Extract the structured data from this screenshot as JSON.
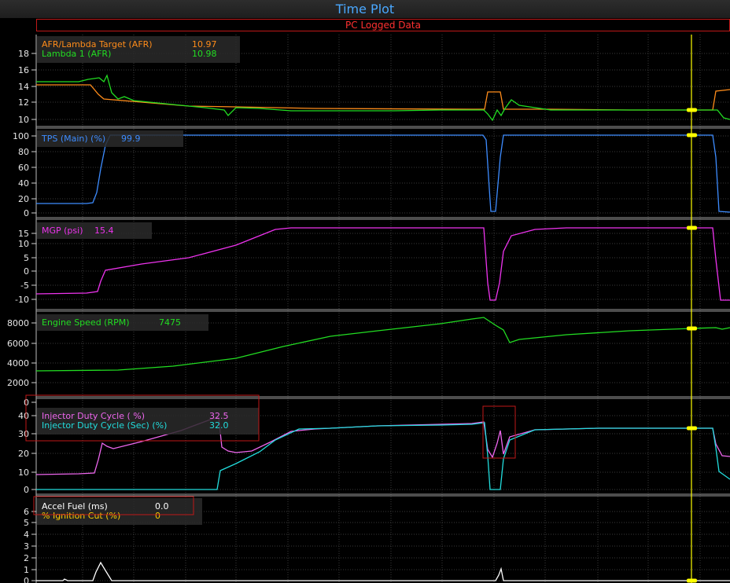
{
  "title": "Time Plot",
  "subtitle": "PC Logged Data",
  "colors": {
    "accent_title": "#4aa8ff",
    "subtitle_text": "#ff3030",
    "highlight_box": "#c01818",
    "cursor": "#ffff00",
    "grid": "#3a3a3a",
    "afr_target": "#ff8c1a",
    "lambda1": "#22dd22",
    "tps": "#3d8cff",
    "mgp": "#ee33ee",
    "rpm": "#22dd22",
    "idc": "#ee66ee",
    "idc_sec": "#22dddd",
    "accel": "#ffffff",
    "ign_cut": "#ffcc00"
  },
  "panels": [
    {
      "id": "afr",
      "yticks": [
        "18",
        "16",
        "14",
        "12",
        "10"
      ],
      "legend": [
        {
          "name": "AFR/Lambda Target (AFR)",
          "value": "10.97",
          "color": "#ff8c1a"
        },
        {
          "name": "Lambda 1 (AFR)",
          "value": "10.98",
          "color": "#22dd22"
        }
      ]
    },
    {
      "id": "tps",
      "yticks": [
        "100",
        "80",
        "60",
        "40",
        "20",
        "0"
      ],
      "legend": [
        {
          "name": "TPS (Main) (%)",
          "value": "99.9",
          "color": "#3d8cff"
        }
      ]
    },
    {
      "id": "mgp",
      "yticks": [
        "15",
        "10",
        "5",
        "0",
        "-5",
        "-10"
      ],
      "legend": [
        {
          "name": "MGP (psi)",
          "value": "15.4",
          "color": "#ee33ee"
        }
      ]
    },
    {
      "id": "rpm",
      "yticks": [
        "8000",
        "6000",
        "4000",
        "2000",
        "0"
      ],
      "legend": [
        {
          "name": "Engine Speed (RPM)",
          "value": "7475",
          "color": "#22dd22"
        }
      ]
    },
    {
      "id": "idc",
      "yticks": [
        "40",
        "30",
        "20",
        "10",
        "0"
      ],
      "legend": [
        {
          "name": "Injector Duty Cycle ( %)",
          "value": "32.5",
          "color": "#ee66ee"
        },
        {
          "name": "Injector Duty Cycle (Sec) (%)",
          "value": "32.0",
          "color": "#22dddd"
        }
      ]
    },
    {
      "id": "accel",
      "yticks": [
        "6",
        "5",
        "4",
        "3",
        "2",
        "1",
        "0"
      ],
      "legend": [
        {
          "name": "Accel Fuel (ms)",
          "value": "0.0",
          "color": "#ffffff"
        },
        {
          "name": "% Ignition Cut (%)",
          "value": "0",
          "color": "#ffcc00"
        }
      ]
    }
  ]
}
